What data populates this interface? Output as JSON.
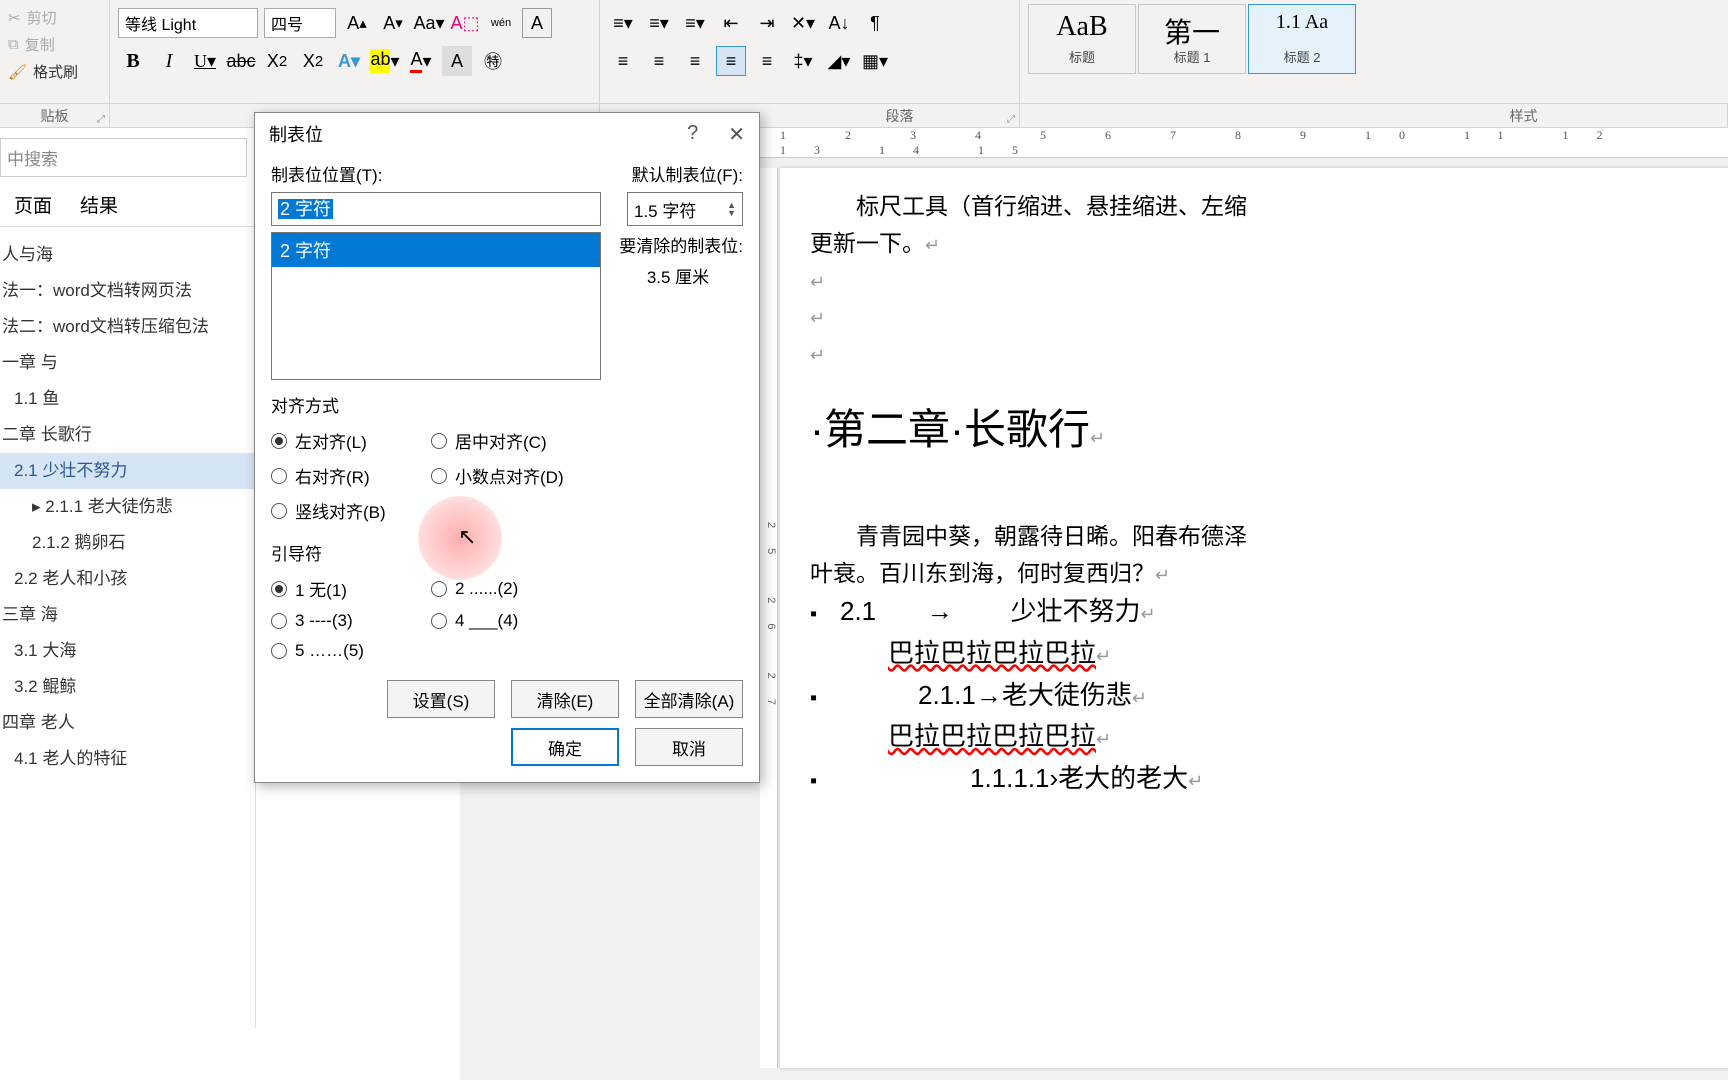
{
  "clipboard": {
    "cut": "剪切",
    "copy": "复制",
    "format_painter": "格式刷",
    "group_label": "贴板"
  },
  "font": {
    "name": "等线 Light",
    "size": "四号"
  },
  "paragraph": {
    "group_label": "段落"
  },
  "styles": {
    "group_label": "样式",
    "items": [
      {
        "preview": "AaB",
        "label": "标题"
      },
      {
        "preview": "第一",
        "label": "标题 1"
      },
      {
        "preview": "1.1  Aa",
        "label": "标题 2"
      }
    ]
  },
  "nav": {
    "search_placeholder": "中搜索",
    "tabs": {
      "pages": "页面",
      "results": "结果"
    },
    "tree": [
      {
        "text": "人与海",
        "lvl": 0
      },
      {
        "text": "法一：word文档转网页法",
        "lvl": 0
      },
      {
        "text": "法二：word文档转压缩包法",
        "lvl": 0
      },
      {
        "text": "一章 与",
        "lvl": 0
      },
      {
        "text": "1.1 鱼",
        "lvl": 1
      },
      {
        "text": "二章 长歌行",
        "lvl": 0
      },
      {
        "text": "2.1 少壮不努力",
        "lvl": 1,
        "sel": true
      },
      {
        "text": "▸ 2.1.1 老大徒伤悲",
        "lvl": 2
      },
      {
        "text": "2.1.2 鹅卵石",
        "lvl": 2
      },
      {
        "text": "2.2 老人和小孩",
        "lvl": 1
      },
      {
        "text": "三章 海",
        "lvl": 0
      },
      {
        "text": "3.1 大海",
        "lvl": 1
      },
      {
        "text": "3.2 鲲鲸",
        "lvl": 1
      },
      {
        "text": "四章 老人",
        "lvl": 0
      },
      {
        "text": "4.1 老人的特征",
        "lvl": 1
      }
    ]
  },
  "ruler": "1 2 3 4 5 6 7 8 9 10 11 12 13 14 15",
  "vruler": "25 26 27",
  "doc": {
    "line1": "标尺工具（首行缩进、悬挂缩进、左缩",
    "line2": "更新一下。",
    "heading": "·第二章·长歌行",
    "para1a": "青青园中葵，朝露待日晞。阳春布德泽",
    "para1b": "叶衰。百川东到海，何时复西归？",
    "l21_num": "2.1",
    "l21_arrow": "→",
    "l21_text": "少壮不努力",
    "bala": "巴拉巴拉巴拉巴拉",
    "l211": "2.1.1→老大徒伤悲",
    "l1111": "1.1.1.1›老大的老大"
  },
  "dialog": {
    "title": "制表位",
    "pos_label": "制表位位置(T):",
    "pos_value": "2 字符",
    "default_label": "默认制表位(F):",
    "default_value": "1.5 字符",
    "list_item": "2 字符",
    "clear_label": "要清除的制表位:",
    "clear_value": "3.5 厘米",
    "align_label": "对齐方式",
    "align": {
      "left": "左对齐(L)",
      "center": "居中对齐(C)",
      "right": "右对齐(R)",
      "decimal": "小数点对齐(D)",
      "bar": "竖线对齐(B)"
    },
    "leader_label": "引导符",
    "leader": {
      "l1": "1 无(1)",
      "l2": "2 ......(2)",
      "l3": "3 ----(3)",
      "l4": "4 ___(4)",
      "l5": "5 ……(5)"
    },
    "btn_set": "设置(S)",
    "btn_clear": "清除(E)",
    "btn_clear_all": "全部清除(A)",
    "btn_ok": "确定",
    "btn_cancel": "取消"
  }
}
